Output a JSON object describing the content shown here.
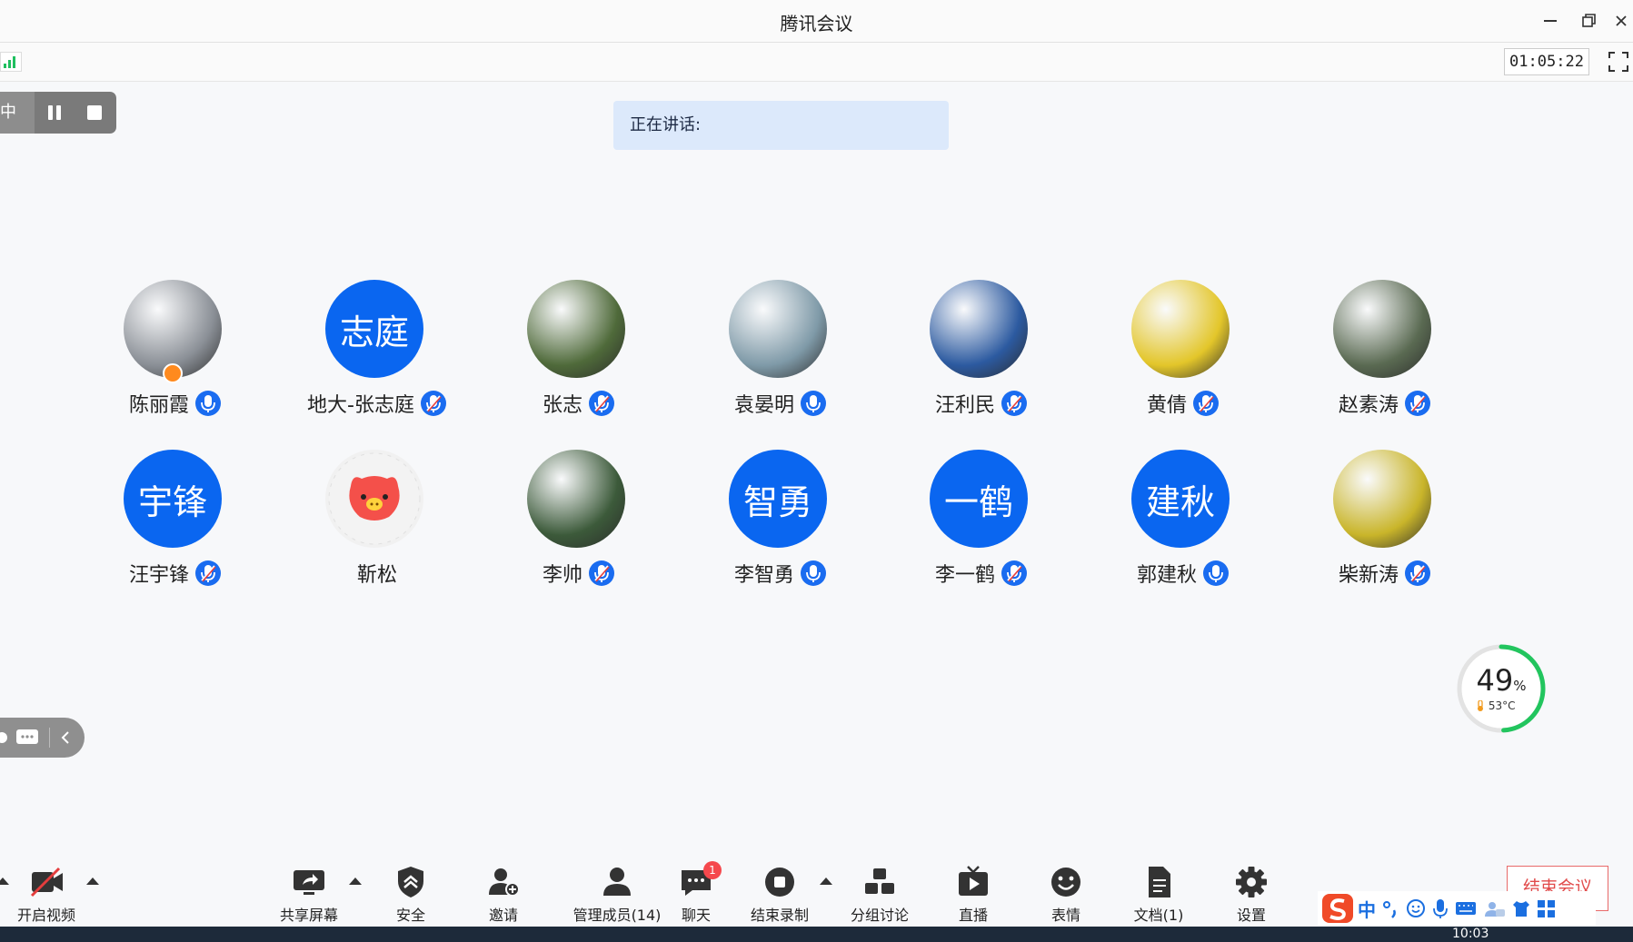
{
  "window": {
    "title": "腾讯会议"
  },
  "topbar": {
    "timer": "01:05:22"
  },
  "recording": {
    "status_label": "中"
  },
  "speaking": {
    "label": "正在讲话:"
  },
  "participants": [
    {
      "name": "陈丽霞",
      "avatar_type": "photo",
      "avatar_color": "#8a8f96",
      "mic": "active",
      "host": true
    },
    {
      "name": "地大-张志庭",
      "avatar_type": "text",
      "avatar_text": "志庭",
      "mic": "muted"
    },
    {
      "name": "张志",
      "avatar_type": "photo",
      "avatar_color": "#4f6a3a",
      "mic": "muted"
    },
    {
      "name": "袁晏明",
      "avatar_type": "photo",
      "avatar_color": "#7f9aa8",
      "mic": "active"
    },
    {
      "name": "汪利民",
      "avatar_type": "photo",
      "avatar_color": "#2c5aa0",
      "mic": "muted"
    },
    {
      "name": "黄倩",
      "avatar_type": "photo",
      "avatar_color": "#e3c62a",
      "mic": "muted"
    },
    {
      "name": "赵素涛",
      "avatar_type": "photo",
      "avatar_color": "#5a6a52",
      "mic": "muted"
    },
    {
      "name": "汪宇锋",
      "avatar_type": "text",
      "avatar_text": "宇锋",
      "mic": "muted"
    },
    {
      "name": "靳松",
      "avatar_type": "cartoon",
      "avatar_color": "#f4504a",
      "mic": "none"
    },
    {
      "name": "李帅",
      "avatar_type": "photo",
      "avatar_color": "#3c5a3a",
      "mic": "muted"
    },
    {
      "name": "李智勇",
      "avatar_type": "text",
      "avatar_text": "智勇",
      "mic": "active"
    },
    {
      "name": "李一鹤",
      "avatar_type": "text",
      "avatar_text": "一鹤",
      "mic": "muted"
    },
    {
      "name": "郭建秋",
      "avatar_type": "text",
      "avatar_text": "建秋",
      "mic": "active"
    },
    {
      "name": "柴新涛",
      "avatar_type": "photo",
      "avatar_color": "#c9b52a",
      "mic": "muted"
    }
  ],
  "perf": {
    "cpu_percent": "49",
    "percent_sign": "%",
    "temperature": "53°C",
    "cpu_fraction": 0.49
  },
  "toolbar": {
    "video": "开启视频",
    "share": "共享屏幕",
    "security": "安全",
    "invite": "邀请",
    "members": "管理成员(14)",
    "chat": "聊天",
    "chat_badge": "1",
    "end_record": "结束录制",
    "breakout": "分组讨论",
    "live": "直播",
    "reaction": "表情",
    "docs": "文档(1)",
    "settings": "设置",
    "end_meeting": "结束会议"
  },
  "ime": {
    "lang": "中"
  },
  "taskbar": {
    "clock": "10:03"
  },
  "colors": {
    "accent": "#0a66f0",
    "signal": "#1fbf5f",
    "danger": "#e14b4b"
  }
}
